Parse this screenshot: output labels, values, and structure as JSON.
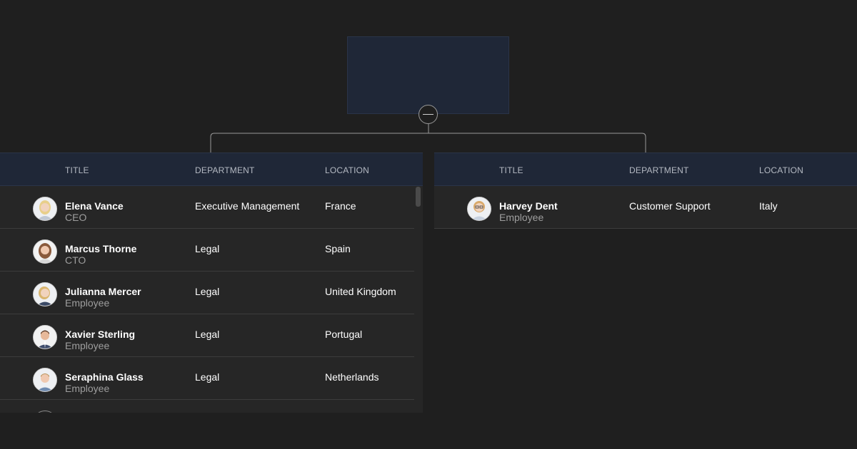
{
  "columns": {
    "title": "TITLE",
    "department": "DEPARTMENT",
    "location": "LOCATION"
  },
  "left_panel": {
    "rows": [
      {
        "name": "Elena Vance",
        "role": "CEO",
        "department": "Executive Management",
        "location": "France",
        "avatar": "woman-blonde-avatar"
      },
      {
        "name": "Marcus Thorne",
        "role": "CTO",
        "department": "Legal",
        "location": "Spain",
        "avatar": "woman-brunette-avatar"
      },
      {
        "name": "Julianna Mercer",
        "role": "Employee",
        "department": "Legal",
        "location": "United Kingdom",
        "avatar": "woman-blonde-avatar"
      },
      {
        "name": "Xavier Sterling",
        "role": "Employee",
        "department": "Legal",
        "location": "Portugal",
        "avatar": "man-dark-hair-avatar"
      },
      {
        "name": "Seraphina Glass",
        "role": "Employee",
        "department": "Legal",
        "location": "Netherlands",
        "avatar": "man-light-hair-avatar"
      }
    ]
  },
  "right_panel": {
    "rows": [
      {
        "name": "Harvey Dent",
        "role": "Employee",
        "department": "Customer Support",
        "location": "Italy",
        "avatar": "woman-glasses-avatar"
      }
    ]
  },
  "colors": {
    "background": "#1f1f1f",
    "panel": "#262626",
    "header": "#1f2737",
    "connector": "#9a9a9a"
  }
}
